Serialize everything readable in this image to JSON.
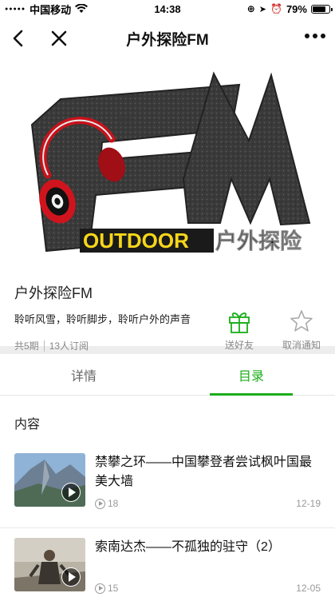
{
  "status": {
    "carrier": "中国移动",
    "time": "14:38",
    "battery": "79%",
    "battery_level": 0.79
  },
  "nav": {
    "title": "户外探险FM"
  },
  "cover": {
    "logo_text": "FM",
    "banner_en": "OUTDOOR",
    "banner_cn": "户外探险"
  },
  "album": {
    "title": "户外探险FM",
    "description": "聆听风雪，聆听脚步，聆听户外的声音",
    "episodes": "共5期",
    "subscribers": "13人订阅",
    "share_label": "送好友",
    "unsubscribe_label": "取消通知"
  },
  "tabs": {
    "details": "详情",
    "catalog": "目录"
  },
  "list": {
    "heading": "内容",
    "items": [
      {
        "title": "禁攀之环——中国攀登者尝试枫叶国最美大墙",
        "plays": "18",
        "date": "12-19"
      },
      {
        "title": "索南达杰——不孤独的驻守（2）",
        "plays": "15",
        "date": "12-05"
      }
    ]
  }
}
